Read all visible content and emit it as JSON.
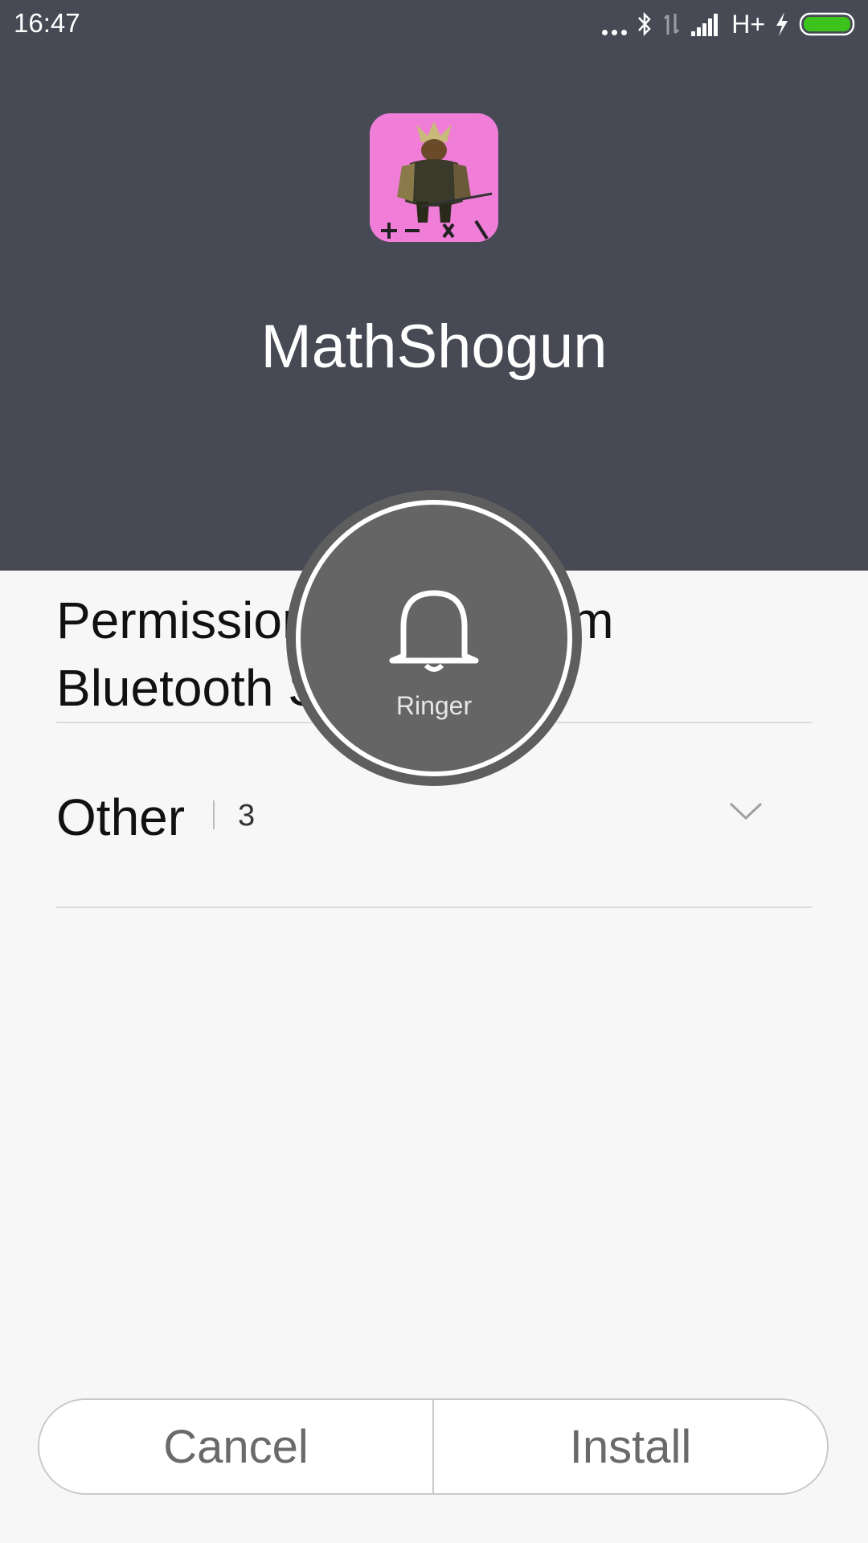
{
  "status_bar": {
    "time": "16:47",
    "network_type": "H+",
    "icons": [
      "more-dots-icon",
      "bluetooth-icon",
      "data-arrows-icon",
      "signal-icon",
      "charging-icon",
      "battery-icon"
    ],
    "battery_color": "#3cc41c"
  },
  "header": {
    "app_name": "MathShogun",
    "app_icon": "samurai-app-icon",
    "background_color": "#474a54"
  },
  "permissions": {
    "title": "Permission request from Bluetooth Share",
    "group_label": "Other",
    "group_count": "3"
  },
  "ringer_overlay": {
    "icon": "bell-icon",
    "label": "Ringer"
  },
  "actions": {
    "cancel_label": "Cancel",
    "install_label": "Install"
  }
}
